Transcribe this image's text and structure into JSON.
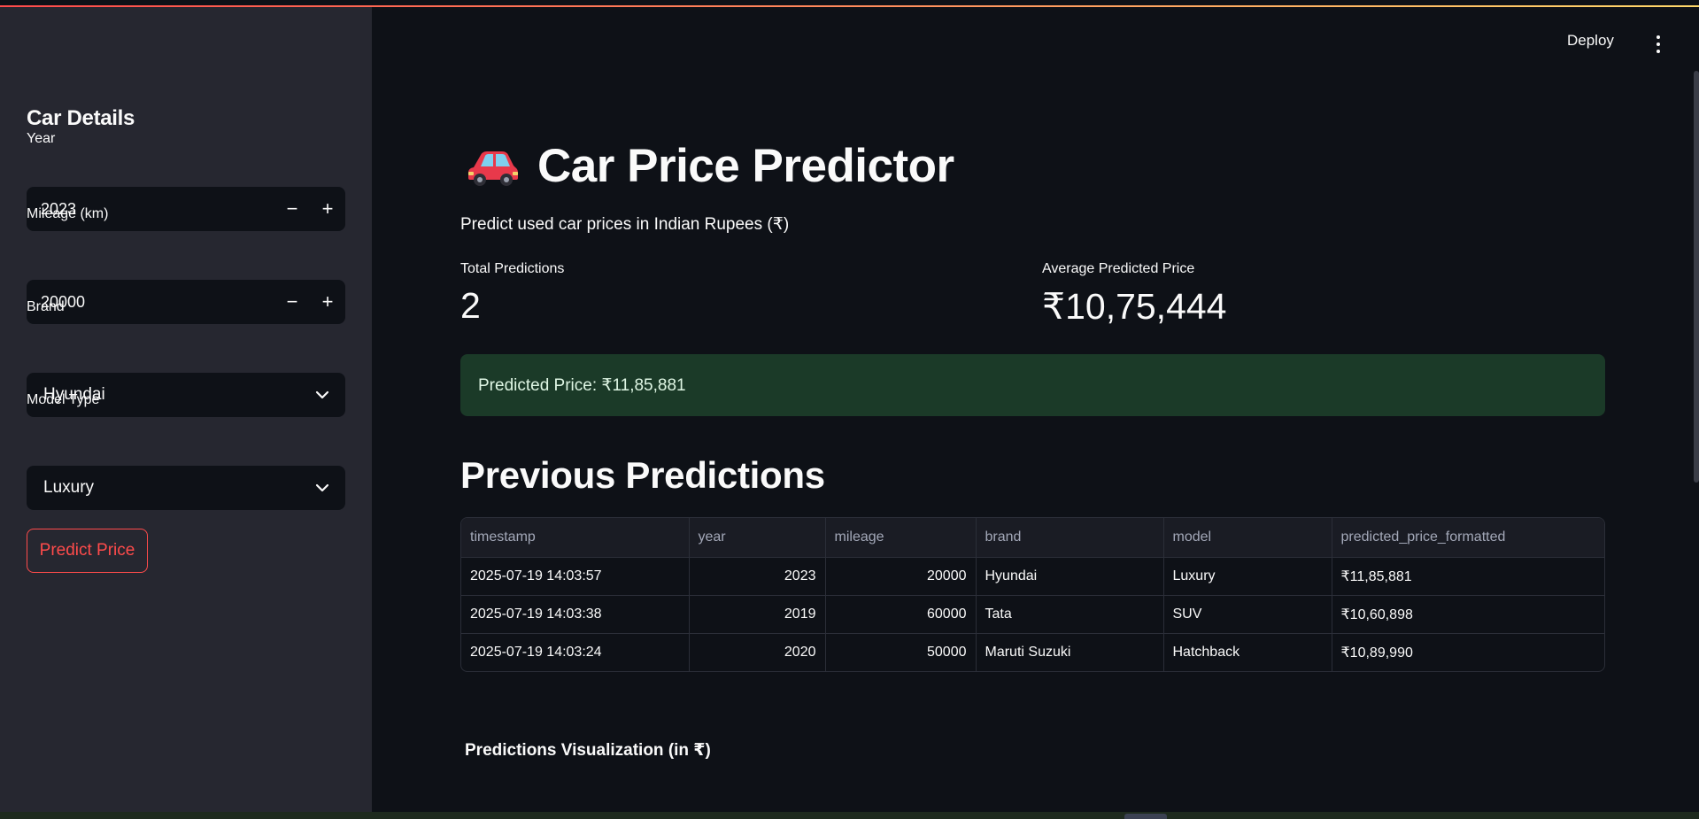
{
  "sidebar": {
    "title": "Car Details",
    "year": {
      "label": "Year",
      "value": "2023"
    },
    "mileage": {
      "label": "Mileage (km)",
      "value": "20000"
    },
    "brand": {
      "label": "Brand",
      "selected": "Hyundai"
    },
    "model_type": {
      "label": "Model Type",
      "selected": "Luxury"
    },
    "predict_button": "Predict Price",
    "stepper_minus": "−",
    "stepper_plus": "+"
  },
  "header": {
    "deploy_label": "Deploy"
  },
  "main": {
    "title": "Car Price Predictor",
    "title_icon": "car-icon",
    "subtitle": "Predict used car prices in Indian Rupees (₹)",
    "metrics": [
      {
        "label": "Total Predictions",
        "value": "2"
      },
      {
        "label": "Average Predicted Price",
        "value": "₹10,75,444"
      }
    ],
    "success_message": "Predicted Price: ₹11,85,881",
    "history_heading": "Previous Predictions",
    "table": {
      "columns": [
        "timestamp",
        "year",
        "mileage",
        "brand",
        "model",
        "predicted_price_formatted"
      ],
      "rows": [
        [
          "2025-07-19 14:03:57",
          "2023",
          "20000",
          "Hyundai",
          "Luxury",
          "₹11,85,881"
        ],
        [
          "2025-07-19 14:03:38",
          "2019",
          "60000",
          "Tata",
          "SUV",
          "₹10,60,898"
        ],
        [
          "2025-07-19 14:03:24",
          "2020",
          "50000",
          "Maruti Suzuki",
          "Hatchback",
          "₹10,89,990"
        ]
      ]
    },
    "viz_title": "Predictions Visualization (in ₹)"
  },
  "colors": {
    "background": "#0e1117",
    "sidebar": "#262730",
    "accent": "#ff4b4b",
    "success_bg": "#1b3a28"
  }
}
